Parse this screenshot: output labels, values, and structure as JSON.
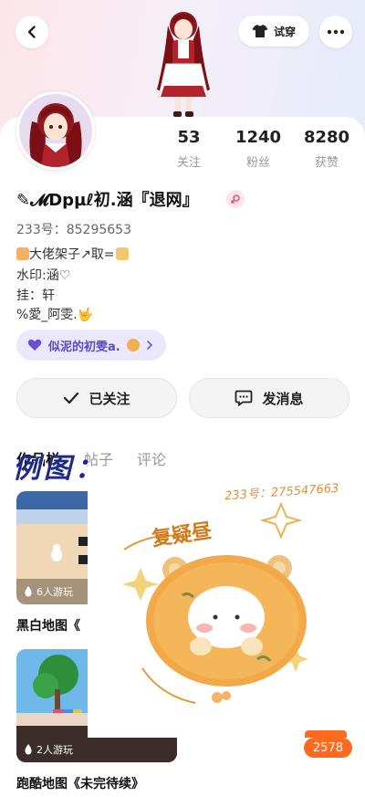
{
  "header": {
    "tryon_label": "试穿"
  },
  "stats": [
    {
      "value": "53",
      "label": "关注"
    },
    {
      "value": "1240",
      "label": "粉丝"
    },
    {
      "value": "8280",
      "label": "获赞"
    }
  ],
  "profile": {
    "nickname": "✎𝓜Dpµℓ初.涵『退网』",
    "uid": "233号：85295653",
    "bio": [
      "大佬架子↗取=",
      "水印:涵♡",
      "挂：轩",
      "%愛_阿雯.🤟"
    ],
    "friend_tag": "似泥的初雯a."
  },
  "actions": {
    "followed": "已关注",
    "message": "发消息"
  },
  "tabs": [
    "作品栏",
    "帖子",
    "评论"
  ],
  "overlay_label": "例图：",
  "games": [
    {
      "plays": "6人游玩",
      "title": "黑白地图《"
    },
    {
      "plays": "2人游玩",
      "title": "跑酷地图《未完待续》"
    }
  ],
  "sticker": {
    "number": "233号：275547663",
    "text": "复疑昼"
  },
  "count_badge": "2578",
  "colors": {
    "accent_purple": "#5a48c8",
    "badge_orange": "#ff6a1f"
  }
}
